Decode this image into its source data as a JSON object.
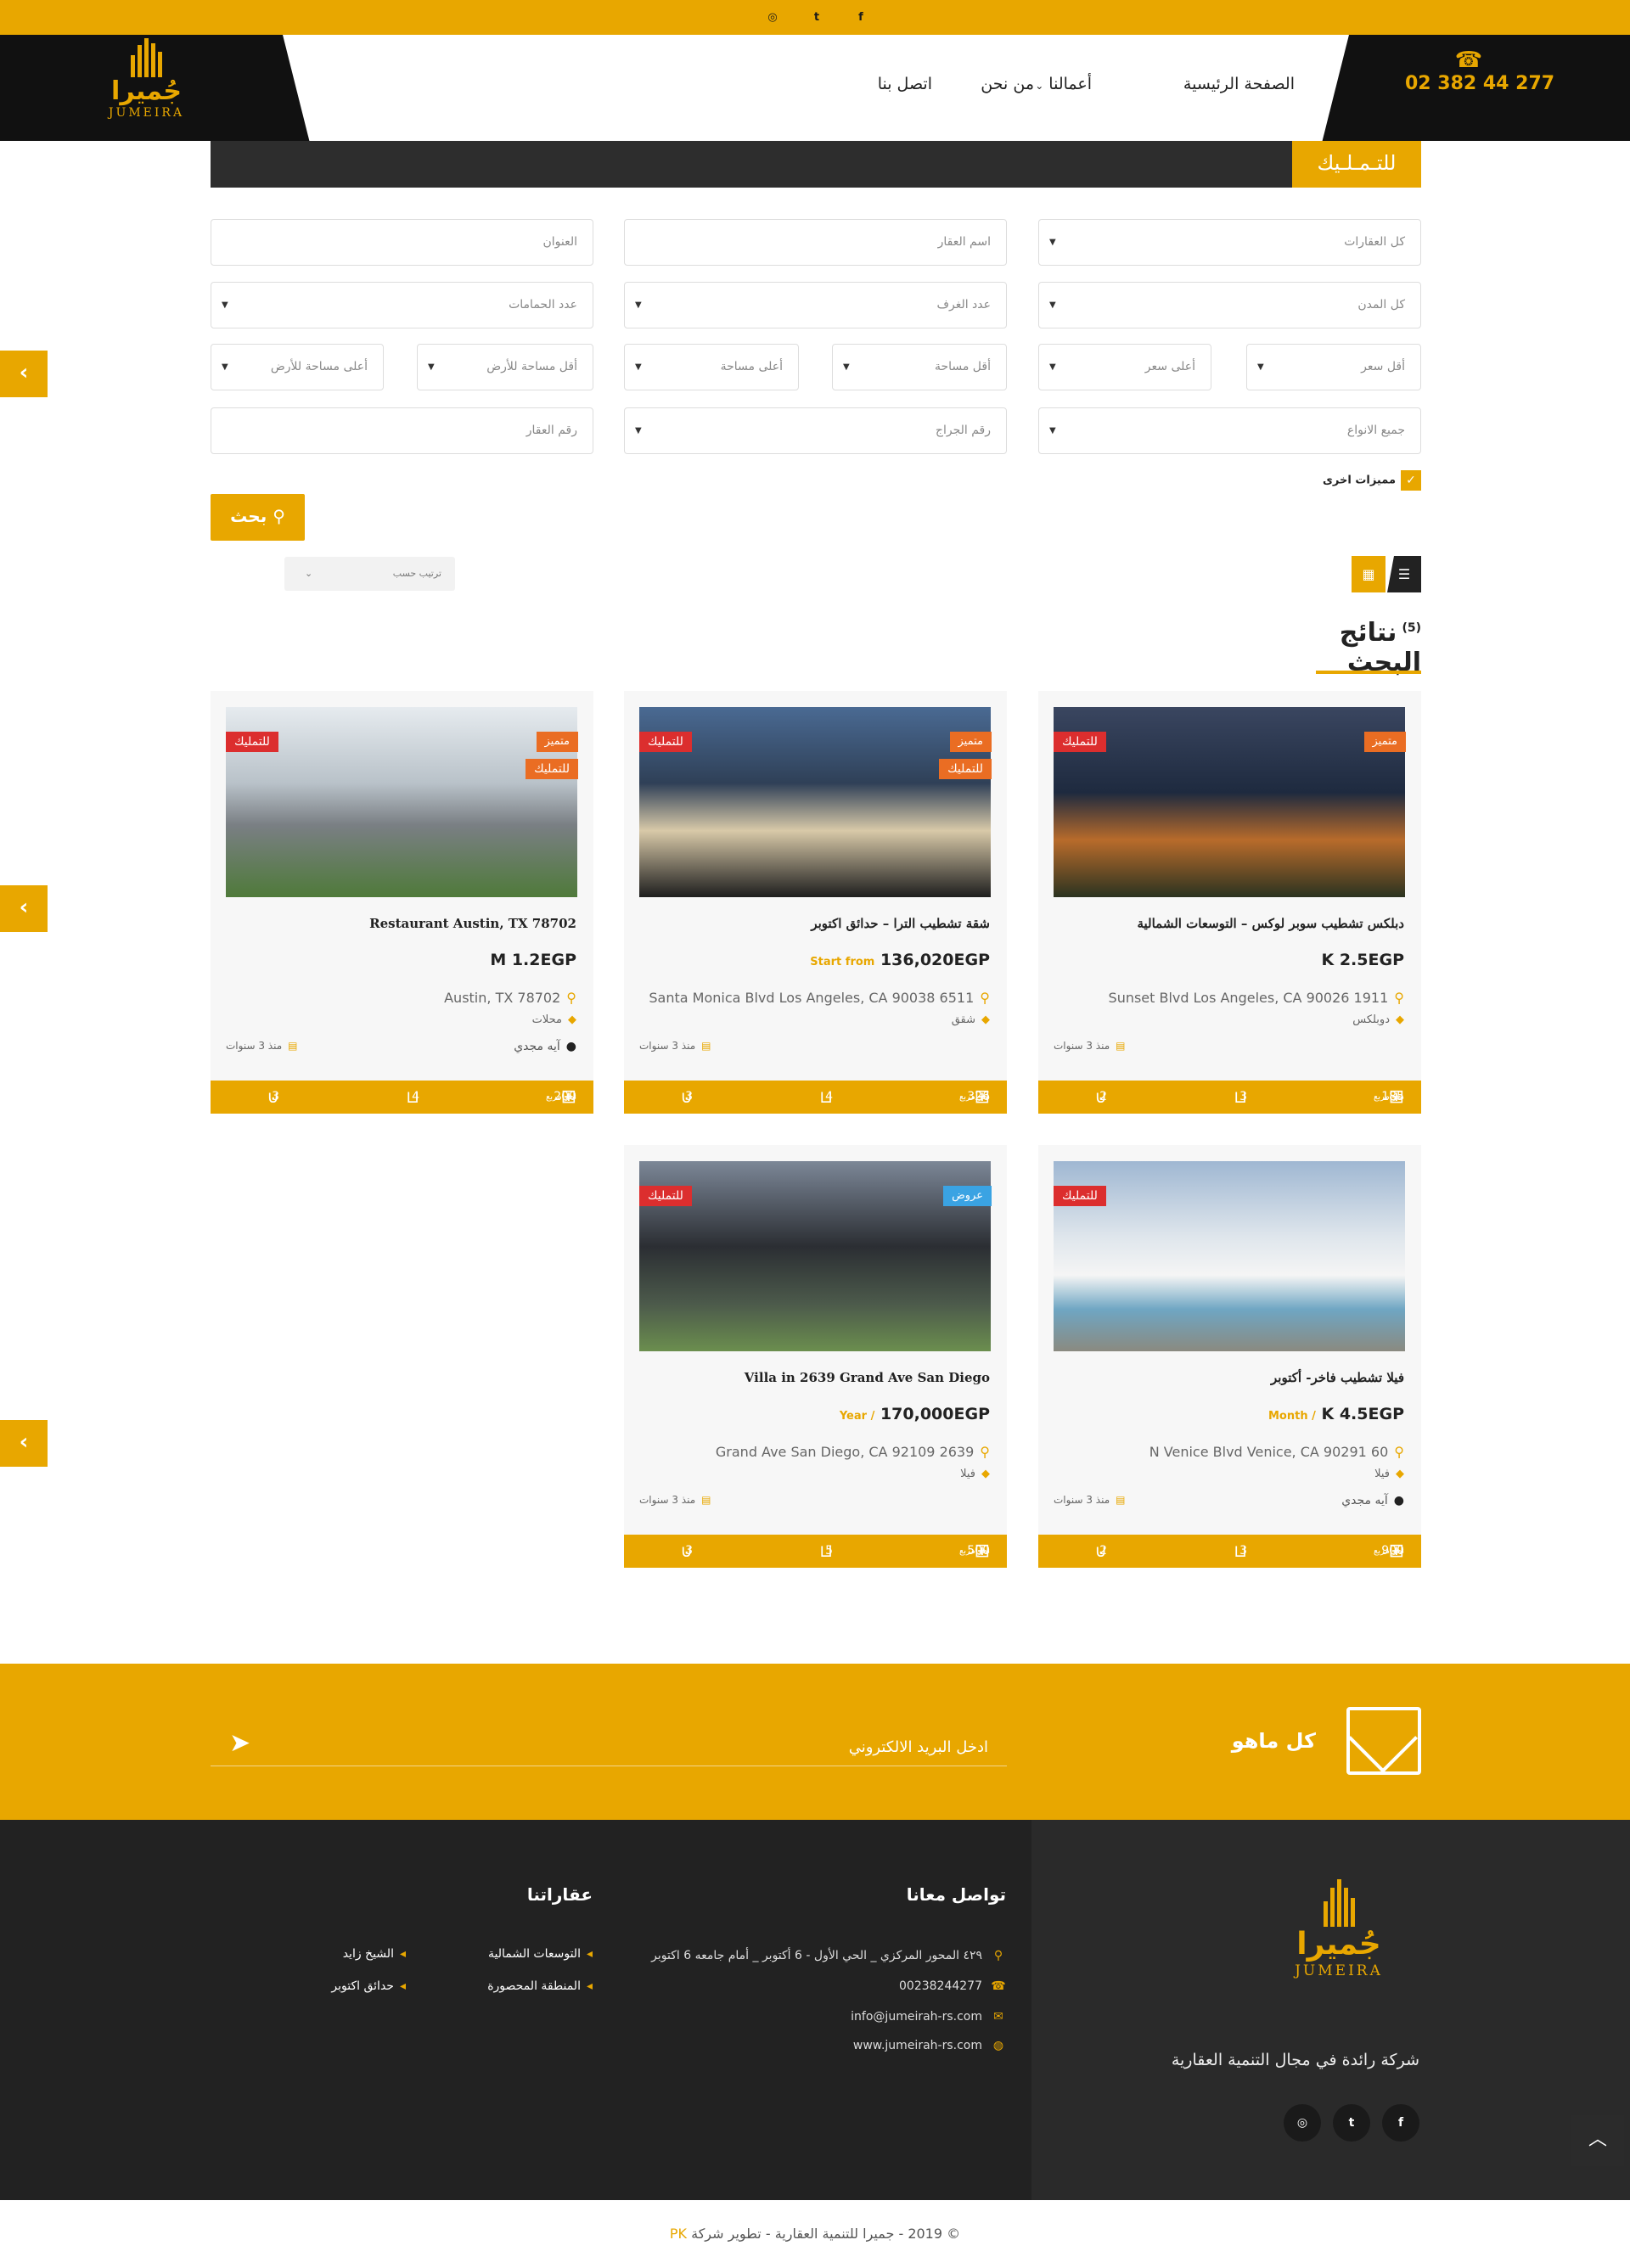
{
  "topbar": {
    "social": [
      "instagram-icon",
      "twitter-icon",
      "facebook-icon"
    ]
  },
  "header": {
    "logo": {
      "arabic": "جُميرا",
      "english": "JUMEIRA"
    },
    "phone": "02 382 44 277",
    "nav": [
      {
        "label": "الصفحة الرئيسية"
      },
      {
        "label": "أعمالنا",
        "has_dropdown": true
      },
      {
        "label": "من نحن"
      },
      {
        "label": "اتصل بنا"
      }
    ]
  },
  "page_title": "للتـمـلـيك",
  "search": {
    "fields": {
      "all_properties": "كل العقارات",
      "property_name": "اسم العقار",
      "address": "العنوان",
      "all_cities": "كل المدن",
      "rooms": "عدد الغرف",
      "baths": "عدد الحمامات",
      "min_price": "أقل سعر",
      "max_price": "أعلى سعر",
      "min_area": "أقل مساحة",
      "max_area": "أعلى مساحة",
      "min_land": "أقل مساحة للأرض",
      "max_land": "أعلى مساحة للأرض",
      "all_types": "جميع الانواع",
      "garage": "رقم الجراج",
      "property_no": "رقم العقار"
    },
    "more_features": "مميزات اخرى",
    "button": "بحث",
    "sort_label": "ترتيب حسب"
  },
  "results": {
    "title": "نتائج البحث",
    "count": "(5)",
    "cards": [
      {
        "title": "دبلكس تشطيب سوبر لوكس – التوسعات الشمالية",
        "price": "K 2.5EGP",
        "price_label": "",
        "address": "Sunset Blvd Los Angeles, CA 90026 1911",
        "type": "دوبلكس",
        "owner": "",
        "age": "منذ 3 سنوات",
        "badge_status": "للتمليك",
        "badge_featured": "متميز",
        "badge_extra": "",
        "area": "185",
        "area_unit": "متر مربع",
        "beds": "3",
        "baths": "2"
      },
      {
        "title": "شقة تشطيب الترا – حدائق اكتوبر",
        "price": "136,020EGP",
        "price_label": "Start from",
        "address": "Santa Monica Blvd Los Angeles, CA 90038 6511",
        "type": "شقق",
        "owner": "",
        "age": "منذ 3 سنوات",
        "badge_status": "للتمليك",
        "badge_featured": "متميز",
        "badge_extra": "للتمليك",
        "area": "326",
        "area_unit": "متر مربع",
        "beds": "4",
        "baths": "3"
      },
      {
        "title": "Restaurant Austin, TX 78702",
        "price": "M 1.2EGP",
        "price_label": "",
        "address": "Austin, TX 78702",
        "type": "محلات",
        "owner": "آيه مجدي",
        "age": "منذ 3 سنوات",
        "badge_status": "للتمليك",
        "badge_featured": "متميز",
        "badge_extra": "للتمليك",
        "area": "200",
        "area_unit": "متر مربع",
        "beds": "4",
        "baths": "3"
      },
      {
        "title": "فيلا تشطيب فاخر- أكتوبر",
        "price": "K 4.5EGP",
        "price_label": "Month /",
        "address": "N Venice Blvd Venice, CA 90291 60",
        "type": "فيلا",
        "owner": "آيه مجدي",
        "age": "منذ 3 سنوات",
        "badge_status": "للتمليك",
        "badge_featured": "",
        "badge_extra": "",
        "area": "900",
        "area_unit": "متر مربع",
        "beds": "3",
        "baths": "2"
      },
      {
        "title": "Villa in 2639 Grand Ave San Diego",
        "price": "170,000EGP",
        "price_label": "Year /",
        "address": "Grand Ave San Diego, CA 92109 2639",
        "type": "فيلا",
        "owner": "",
        "age": "منذ 3 سنوات",
        "badge_status": "للتمليك",
        "badge_featured": "عروض",
        "badge_extra": "",
        "area": "500",
        "area_unit": "متر مربع",
        "beds": "5",
        "baths": "3"
      }
    ]
  },
  "newsletter": {
    "label": "كل ماهو جديد",
    "placeholder": "ادخل البريد الالكتروني"
  },
  "footer": {
    "tagline": "شركة رائدة في مجال التنمية العقارية",
    "contact_title": "تواصل معانا",
    "contact": {
      "address": "٤٢٩ المحور المركزي _ الحي الأول - 6 أكتوبر _ أمام جامعه 6 اكتوبر",
      "phone": "00238244277",
      "email": "info@jumeirah-rs.com",
      "website": "www.jumeirah-rs.com"
    },
    "properties_title": "عقاراتنا",
    "properties": [
      "التوسعات الشمالية",
      "الشيخ زايد",
      "المنطقة المحصورة",
      "حدائق اكتوبر"
    ],
    "social": [
      "instagram-icon",
      "twitter-icon",
      "facebook-icon"
    ]
  },
  "copyright": {
    "text": "© 2019 - جميرا للتنمية العقارية - تطوير شركة",
    "brand": "PK"
  },
  "colors": {
    "accent": "#e8a700",
    "dark": "#222222",
    "badge_red": "#dc2e2e",
    "badge_orange": "#ea6d23",
    "badge_blue": "#3aa3e3"
  }
}
